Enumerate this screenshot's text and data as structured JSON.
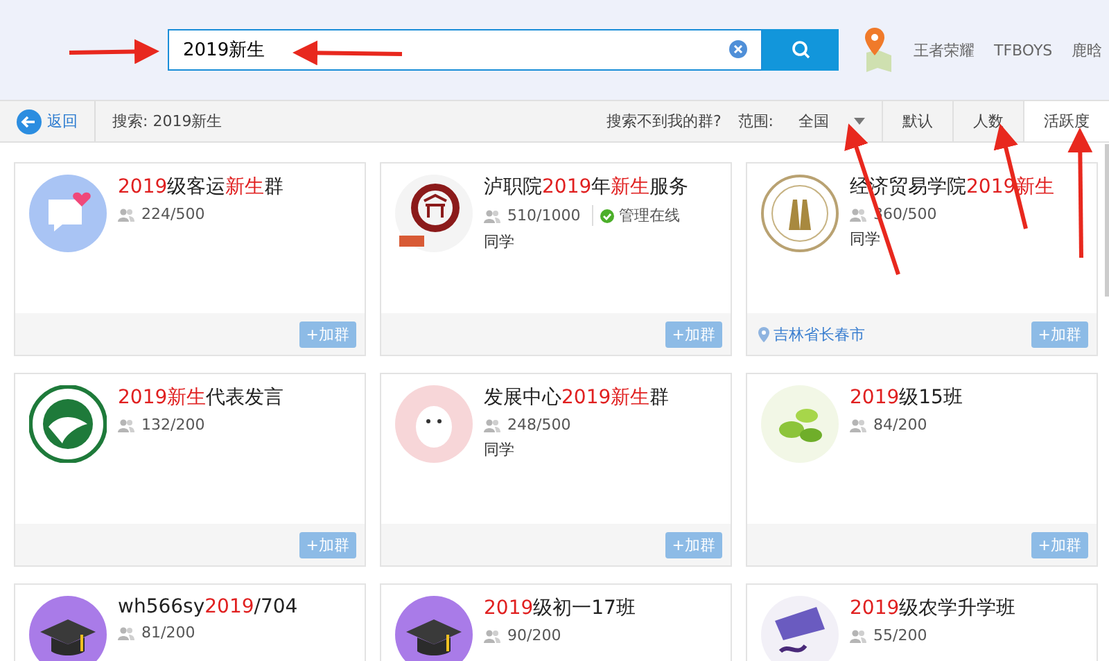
{
  "search": {
    "value": "2019新生"
  },
  "hot_tags": [
    "王者荣耀",
    "TFBOYS",
    "鹿晗"
  ],
  "toolbar": {
    "back": "返回",
    "query": "搜索: 2019新生",
    "help": "搜索不到我的群?",
    "range_label": "范围:",
    "range_value": "全国",
    "sorts": [
      {
        "label": "默认",
        "selected": false
      },
      {
        "label": "人数",
        "selected": false
      },
      {
        "label": "活跃度",
        "selected": true
      }
    ]
  },
  "groups": [
    {
      "avatar": {
        "kind": "chat"
      },
      "name": [
        {
          "text": "2019",
          "hl": true
        },
        {
          "text": "级客运",
          "hl": false
        },
        {
          "text": "新生",
          "hl": true
        },
        {
          "text": "群",
          "hl": false
        }
      ],
      "members": "224/500",
      "admin_online": false,
      "join": "+加群"
    },
    {
      "avatar": {
        "kind": "red-seal"
      },
      "name": [
        {
          "text": "泸职院",
          "hl": false
        },
        {
          "text": "2019",
          "hl": true
        },
        {
          "text": "年",
          "hl": false
        },
        {
          "text": "新生",
          "hl": true
        },
        {
          "text": "服务",
          "hl": false
        }
      ],
      "members": "510/1000",
      "admin_online": true,
      "admin_text": "管理在线",
      "tag": "同学",
      "join": "+加群"
    },
    {
      "avatar": {
        "kind": "gold-seal"
      },
      "name": [
        {
          "text": "经济贸易学院",
          "hl": false
        },
        {
          "text": "2019新生",
          "hl": true
        }
      ],
      "members": "360/500",
      "admin_online": false,
      "tag": "同学",
      "location": "吉林省长春市",
      "join": "+加群"
    },
    {
      "avatar": {
        "kind": "green-emblem"
      },
      "name": [
        {
          "text": "2019新生",
          "hl": true
        },
        {
          "text": "代表发言",
          "hl": false
        }
      ],
      "members": "132/200",
      "admin_online": false,
      "join": "+加群"
    },
    {
      "avatar": {
        "kind": "bear"
      },
      "name": [
        {
          "text": "发展中心",
          "hl": false
        },
        {
          "text": "2019新生",
          "hl": true
        },
        {
          "text": "群",
          "hl": false
        }
      ],
      "members": "248/500",
      "admin_online": false,
      "tag": "同学",
      "join": "+加群"
    },
    {
      "avatar": {
        "kind": "leaf"
      },
      "name": [
        {
          "text": "2019",
          "hl": true
        },
        {
          "text": "级15班",
          "hl": false
        }
      ],
      "members": "84/200",
      "admin_online": false,
      "join": "+加群"
    },
    {
      "avatar": {
        "kind": "cap"
      },
      "name": [
        {
          "text": "wh566sy",
          "hl": false
        },
        {
          "text": "2019",
          "hl": true
        },
        {
          "text": "/704",
          "hl": false
        }
      ],
      "members": "81/200",
      "admin_online": false
    },
    {
      "avatar": {
        "kind": "cap"
      },
      "name": [
        {
          "text": "2019",
          "hl": true
        },
        {
          "text": "级初一17班",
          "hl": false
        }
      ],
      "members": "90/200",
      "admin_online": false
    },
    {
      "avatar": {
        "kind": "art"
      },
      "name": [
        {
          "text": "2019",
          "hl": true
        },
        {
          "text": "级农学升学班",
          "hl": false
        }
      ],
      "members": "55/200",
      "admin_online": false
    }
  ]
}
